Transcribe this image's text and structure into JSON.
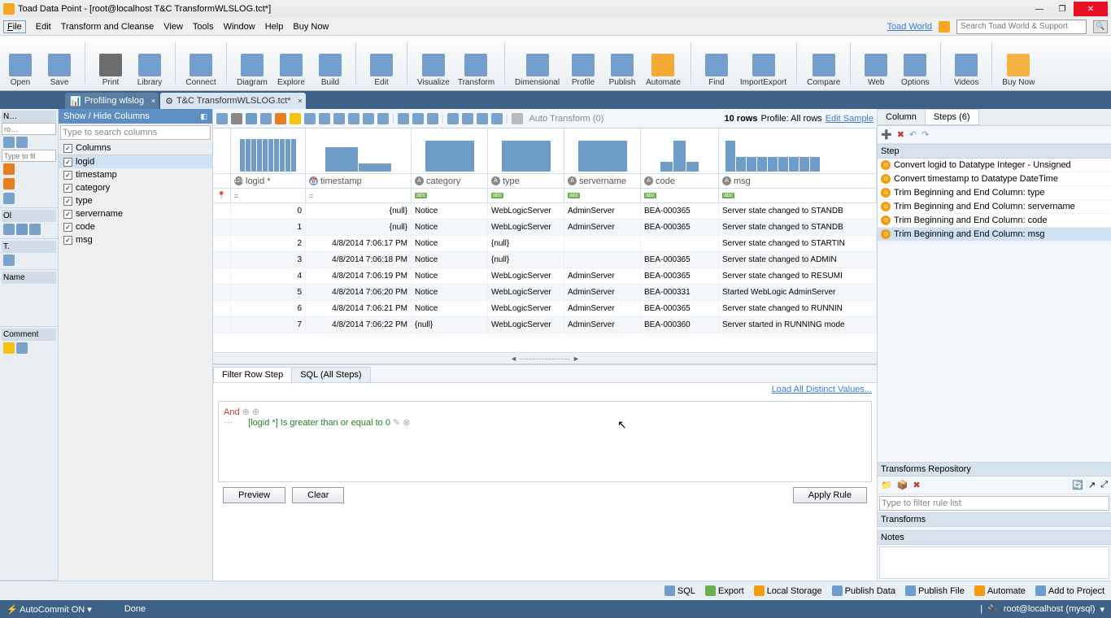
{
  "window": {
    "title": "Toad Data Point - [root@localhost T&C  TransformWLSLOG.tct*]"
  },
  "menu": {
    "items": [
      "File",
      "Edit",
      "Transform and Cleanse",
      "View",
      "Tools",
      "Window",
      "Help",
      "Buy Now"
    ],
    "toad_world": "Toad World",
    "search_placeholder": "Search Toad World & Support"
  },
  "ribbon": [
    "Open",
    "Save",
    "Print",
    "Library",
    "Connect",
    "Diagram",
    "Explore",
    "Build",
    "Edit",
    "Visualize",
    "Transform",
    "Dimensional",
    "Profile",
    "Publish",
    "Automate",
    "Find",
    "ImportExport",
    "Compare",
    "Web",
    "Options",
    "Videos",
    "Buy Now"
  ],
  "tabs": {
    "profiling": "Profiling wlslog",
    "transform": "T&C  TransformWLSLOG.tct*"
  },
  "left": {
    "nav_header": "N…",
    "ro_placeholder": "ro…",
    "filter_placeholder": "Type to fil",
    "object_label": "Ol",
    "t_label": "T.",
    "name_label": "Name",
    "comment_label": "Comment"
  },
  "cols_panel": {
    "title": "Show / Hide Columns",
    "search_placeholder": "Type to search columns",
    "header": "Columns",
    "items": [
      "logid",
      "timestamp",
      "category",
      "type",
      "servername",
      "code",
      "msg"
    ]
  },
  "sub_toolbar": {
    "auto_transform": "Auto Transform (0)",
    "rows_label": "10 rows",
    "profile_label": "Profile: All rows",
    "edit_sample": "Edit Sample"
  },
  "grid": {
    "columns": [
      "logid *",
      "timestamp",
      "category",
      "type",
      "servername",
      "code",
      "msg"
    ],
    "col_types": [
      "123",
      "cal",
      "A",
      "A",
      "A",
      "A",
      "A"
    ],
    "filter_ops": [
      "=",
      "=",
      "",
      "",
      "",
      "",
      ""
    ],
    "rows": [
      {
        "n": "0",
        "cells": [
          "",
          "{null}",
          "Notice",
          "WebLogicServer",
          "AdminServer",
          "BEA-000365",
          "Server state changed to STANDB"
        ]
      },
      {
        "n": "1",
        "cells": [
          "",
          "{null}",
          "Notice",
          "WebLogicServer",
          "AdminServer",
          "BEA-000365",
          "Server state changed to STANDB"
        ]
      },
      {
        "n": "2",
        "cells": [
          "",
          "4/8/2014 7:06:17 PM",
          "Notice",
          "{null}",
          "",
          "",
          "Server state changed to STARTIN"
        ]
      },
      {
        "n": "3",
        "cells": [
          "",
          "4/8/2014 7:06:18 PM",
          "Notice",
          "{null}",
          "",
          "BEA-000365",
          "Server state changed to ADMIN"
        ]
      },
      {
        "n": "4",
        "cells": [
          "",
          "4/8/2014 7:06:19 PM",
          "Notice",
          "WebLogicServer",
          "AdminServer",
          "BEA-000365",
          "Server state changed to RESUMI"
        ]
      },
      {
        "n": "5",
        "cells": [
          "",
          "4/8/2014 7:06:20 PM",
          "Notice",
          "WebLogicServer",
          "AdminServer",
          "BEA-000331",
          "Started WebLogic AdminServer"
        ]
      },
      {
        "n": "6",
        "cells": [
          "",
          "4/8/2014 7:06:21 PM",
          "Notice",
          "WebLogicServer",
          "AdminServer",
          "BEA-000365",
          "Server state changed to RUNNIN"
        ]
      },
      {
        "n": "7",
        "cells": [
          "",
          "4/8/2014 7:06:22 PM",
          "{null}",
          "WebLogicServer",
          "AdminServer",
          "BEA-000360",
          "Server started in RUNNING mode"
        ]
      }
    ]
  },
  "filter": {
    "tab_row": "Filter Row Step",
    "tab_sql": "SQL (All Steps)",
    "load_link": "Load All Distinct Values...",
    "and_label": "And",
    "expression": "[logid *] Is greater than or equal to 0",
    "preview": "Preview",
    "clear": "Clear",
    "apply": "Apply Rule"
  },
  "steps_panel": {
    "tab_column": "Column",
    "tab_steps": "Steps (6)",
    "header": "Step",
    "steps": [
      "Convert logid to Datatype Integer - Unsigned",
      "Convert timestamp to Datatype DateTime",
      "Trim Beginning and End Column: type",
      "Trim Beginning and End Column: servername",
      "Trim Beginning and End Column: code",
      "Trim Beginning and End Column: msg"
    ],
    "repo_title": "Transforms Repository",
    "filter_placeholder": "Type to filter rule list",
    "transforms_label": "Transforms",
    "notes_label": "Notes"
  },
  "bottom": {
    "items": [
      "SQL",
      "Export",
      "Local Storage",
      "Publish Data",
      "Publish File",
      "Automate",
      "Add to Project"
    ]
  },
  "status": {
    "autocommit": "AutoCommit ON",
    "done": "Done",
    "connection": "root@localhost (mysql)"
  }
}
